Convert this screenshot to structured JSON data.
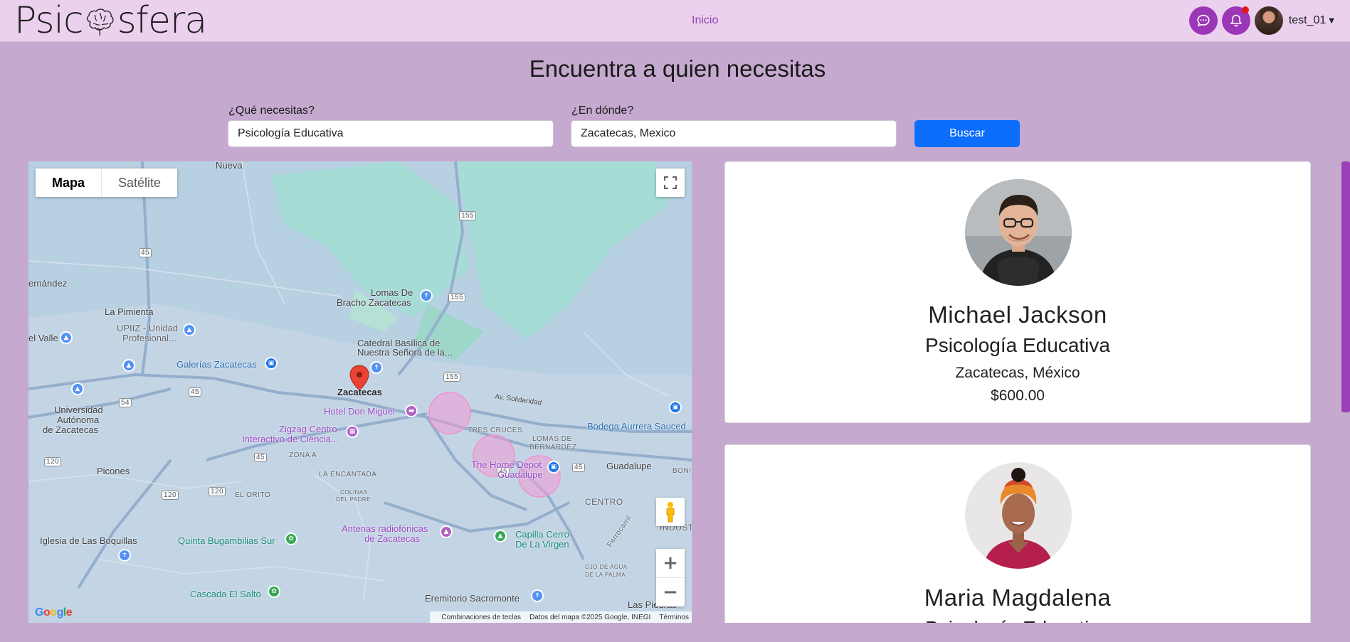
{
  "navbar": {
    "brand_part1": "Psic",
    "brand_part2": "sfera",
    "home_link": "Inicio",
    "username": "test_01",
    "icons": [
      "chat-icon",
      "bell-icon",
      "chevron-down-icon"
    ]
  },
  "page": {
    "title": "Encuentra a quien necesitas"
  },
  "search": {
    "what_label": "¿Qué necesitas?",
    "what_value": "Psicología Educativa",
    "where_label": "¿En dónde?",
    "where_value": "Zacatecas, Mexico",
    "button_label": "Buscar"
  },
  "map": {
    "type_map": "Mapa",
    "type_satellite": "Satélite",
    "labels": {
      "nueva": "Nueva",
      "hernandez": "ernández",
      "la_pimienta": "La Pimienta",
      "upiiz_1": "UPIIZ - Unidad",
      "upiiz_2": "Profesional...",
      "el_valle": "el Valle",
      "galerias": "Galerías Zacatecas",
      "lomas_de_1": "Lomas De",
      "lomas_de_2": "Bracho Zacatecas",
      "catedral_1": "Catedral Basílica de",
      "catedral_2": "Nuestra Señora de la...",
      "zacatecas": "Zacatecas",
      "hotel": "Hotel Don Miguel",
      "universidad_1": "Universidad",
      "universidad_2": "Autónoma",
      "universidad_3": "de Zacatecas",
      "zigzag_1": "Zigzag Centro",
      "zigzag_2": "Interactivo de Ciencia...",
      "av_solidaridad": "Av. Solidaridad",
      "tres_cruces": "TRES CRUCES",
      "lomas_bernardez_1": "LOMAS DE",
      "lomas_bernardez_2": "BERNARDEZ",
      "bodega": "Bodega Aurrera Sauced",
      "zona_a": "ZONA A",
      "home_depot_1": "The Home Depot",
      "home_depot_2": "Guadalupe",
      "guadalupe": "Guadalupe",
      "bonit": "BONIT",
      "picones": "Picones",
      "la_encantada": "LA ENCANTADA",
      "colinas_1": "COLINAS",
      "colinas_2": "DEL PADRE",
      "el_orito": "EL ORITO",
      "centro": "CENTRO",
      "pa": "PA",
      "industria": "INDUSTRIA",
      "antenas_1": "Antenas radiofónicas",
      "antenas_2": "de Zacatecas",
      "quinta": "Quinta Bugambilias Sur",
      "capilla_1": "Capilla Cerro",
      "capilla_2": "De La Virgen",
      "ferrocarril": "Ferrocarril",
      "iglesia": "Iglesia de Las Boquillas",
      "ojo_1": "OJO DE AGUA",
      "ojo_2": "DE LA PALMA",
      "cascada": "Cascada El Salto",
      "eremitorio": "Eremitorio Sacromonte",
      "las_piedras": "Las Piedras"
    },
    "road_shields": {
      "r155a": "155",
      "r155b": "155",
      "r155c": "155",
      "r45a": "45",
      "r45b": "45",
      "r45c": "45",
      "r45d": "45",
      "r45e": "45",
      "r54": "54",
      "r120a": "120",
      "r120b": "120",
      "r120c": "120"
    },
    "google": "Google",
    "attribution": {
      "shortcuts": "Combinaciones de teclas",
      "data": "Datos del mapa ©2025 Google, INEGI",
      "terms": "Términos"
    }
  },
  "results": [
    {
      "name": "Michael Jackson",
      "specialty": "Psicología Educativa",
      "location": "Zacatecas, México",
      "price": "$600.00"
    },
    {
      "name": "Maria Magdalena",
      "specialty": "Psicología Educativa"
    }
  ],
  "colors": {
    "page_bg": "#c6a9cf",
    "navbar_bg": "#ecd1ee",
    "accent_purple": "#9b37b7",
    "primary_blue": "#0d6efd",
    "notification_red": "#e4161b"
  }
}
